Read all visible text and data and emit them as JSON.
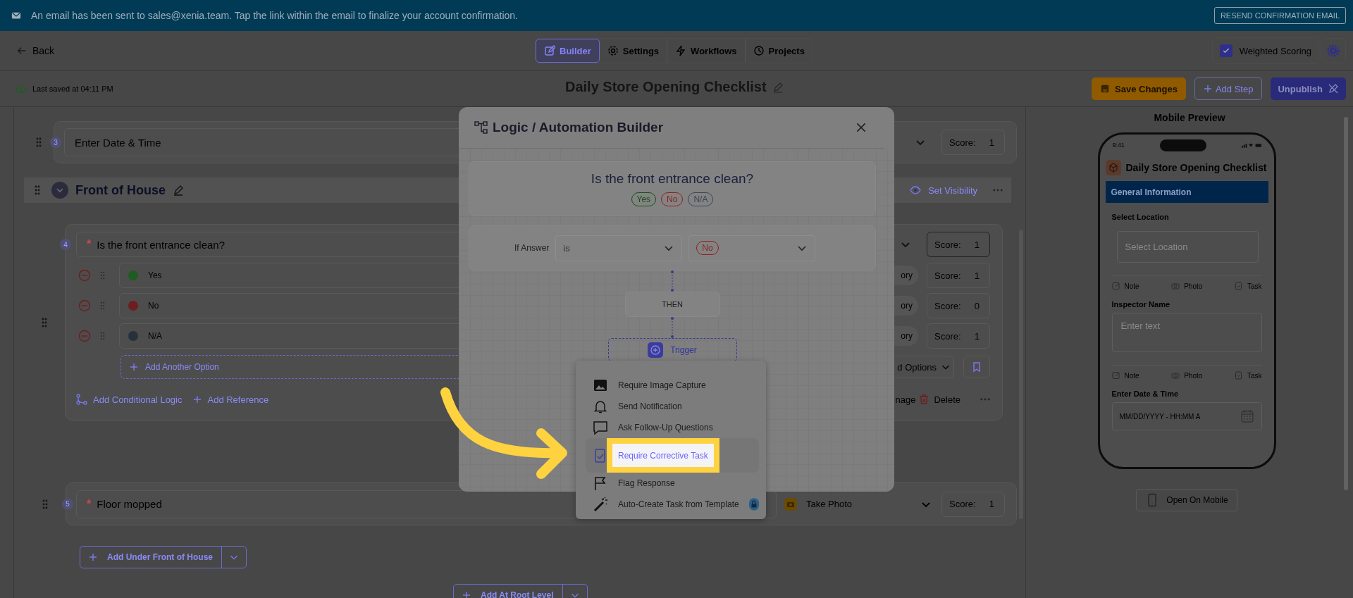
{
  "banner": {
    "message": "An email has been sent to sales@xenia.team. Tap the link within the email to finalize your account confirmation.",
    "button": "RESEND CONFIRMATION EMAIL"
  },
  "nav": {
    "back": "Back",
    "tabs": [
      {
        "label": "Builder",
        "selected": true
      },
      {
        "label": "Settings",
        "selected": false
      },
      {
        "label": "Workflows",
        "selected": false
      },
      {
        "label": "Projects",
        "selected": false
      }
    ],
    "weighted_scoring": {
      "label": "Weighted Scoring",
      "checked": true
    }
  },
  "toolbar": {
    "last_saved": "Last saved at 04:11 PM",
    "title": "Daily Store Opening Checklist",
    "save": "Save Changes",
    "add_step": "Add Step",
    "unpublish": "Unpublish"
  },
  "builder": {
    "question_3": {
      "number": "3",
      "text": "Enter Date & Time",
      "score": {
        "label": "Score:",
        "value": "1"
      }
    },
    "section": {
      "title": "Front of House",
      "set_visibility": "Set Visibility"
    },
    "question_4": {
      "number": "4",
      "required_mark": "*",
      "text": "Is the front entrance clean?",
      "score": {
        "label": "Score:",
        "value": "1"
      },
      "options": [
        {
          "label": "Yes",
          "color": "#1f5c22",
          "category": "ory",
          "score": {
            "label": "Score:",
            "value": "1"
          }
        },
        {
          "label": "No",
          "color": "#6e1e1e",
          "category": "ory",
          "score": {
            "label": "Score:",
            "value": "0"
          }
        },
        {
          "label": "N/A",
          "color": "#26313c",
          "category": "ory",
          "score": {
            "label": "Score:",
            "value": "1"
          }
        }
      ],
      "add_option": "Add Another Option",
      "options_select": "d Options",
      "actions": [
        "Add Conditional Logic",
        "Add Reference"
      ],
      "manage": "nage",
      "delete": "Delete"
    },
    "question_5": {
      "number": "5",
      "required_mark": "*",
      "text": "Floor mopped",
      "response_type": "Take Photo",
      "score": {
        "label": "Score:",
        "value": "1"
      }
    },
    "add_under": "Add Under Front of House",
    "add_root": "Add At Root Level"
  },
  "modal": {
    "title": "Logic / Automation Builder",
    "question": "Is the front entrance clean?",
    "answers": [
      {
        "label": "Yes",
        "color": "#145214"
      },
      {
        "label": "No",
        "color": "#8e1f1f"
      },
      {
        "label": "N/A",
        "color": "#3d4650"
      }
    ],
    "condition": {
      "label": "If Answer",
      "operator": "is",
      "value": "No"
    },
    "then": "THEN",
    "trigger": "Trigger",
    "menu": [
      {
        "label": "Require Image Capture",
        "selected": false,
        "locked": false
      },
      {
        "label": "Send Notification",
        "selected": false,
        "locked": false
      },
      {
        "label": "Ask Follow-Up Questions",
        "selected": false,
        "locked": false
      },
      {
        "label": "Require Corrective Task",
        "selected": true,
        "locked": false
      },
      {
        "label": "Flag Response",
        "selected": false,
        "locked": false
      },
      {
        "label": "Auto-Create Task from Template",
        "selected": false,
        "locked": true
      }
    ]
  },
  "preview": {
    "title": "Mobile Preview",
    "time": "9:41",
    "form_title": "Daily Store Opening Checklist",
    "section": "General Information",
    "fields": [
      {
        "kind": "select",
        "label": "Select Location",
        "placeholder": "Select Location",
        "actions": [
          "Note",
          "Photo",
          "Task"
        ]
      },
      {
        "kind": "text",
        "label": "Inspector Name",
        "placeholder": "Enter text",
        "actions": [
          "Note",
          "Photo",
          "Task"
        ]
      },
      {
        "kind": "datetime",
        "label": "Enter Date & Time",
        "placeholder": "MM/DD/YYYY - HH:MM A"
      }
    ],
    "open_button": "Open On Mobile"
  }
}
